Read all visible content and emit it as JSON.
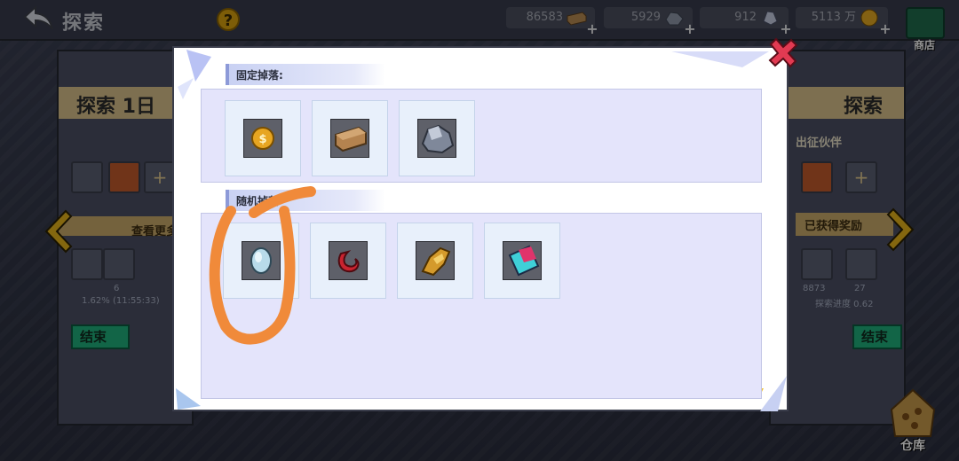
{
  "header": {
    "title": "探索",
    "help": "?",
    "resources": [
      {
        "value": "86583",
        "icon": "wood-plank-icon"
      },
      {
        "value": "5929",
        "icon": "iron-ore-icon"
      },
      {
        "value": "912",
        "icon": "crystal-ore-icon"
      },
      {
        "value": "5113 万",
        "icon": "gold-coin-icon"
      }
    ],
    "shop_label": "商店"
  },
  "background": {
    "left_title": "探索 1日",
    "left_button": "结束",
    "left_view": "查看更多",
    "left_progress": "1.62% (11:55:33)",
    "left_slot_count": "6",
    "right_title": "探索",
    "right_partner": "出征伙伴",
    "right_reward": "已获得奖励",
    "right_count_1": "8873",
    "right_count_2": "27",
    "right_progress": "探索进度 0.62",
    "right_button": "结束",
    "warehouse_label": "仓库"
  },
  "modal": {
    "fixed_drop": {
      "title": "固定掉落:",
      "items": [
        "gold-coin-icon",
        "wood-plank-icon",
        "iron-ore-icon"
      ]
    },
    "random_drop": {
      "title": "随机掉落",
      "items": [
        "mirror-icon",
        "red-horn-icon",
        "golden-gauntlet-icon",
        "gem-card-icon"
      ]
    }
  },
  "colors": {
    "accent_orange": "#f08a3a",
    "panel_lavender": "#e4e4fb",
    "close_red": "#e23a52"
  }
}
